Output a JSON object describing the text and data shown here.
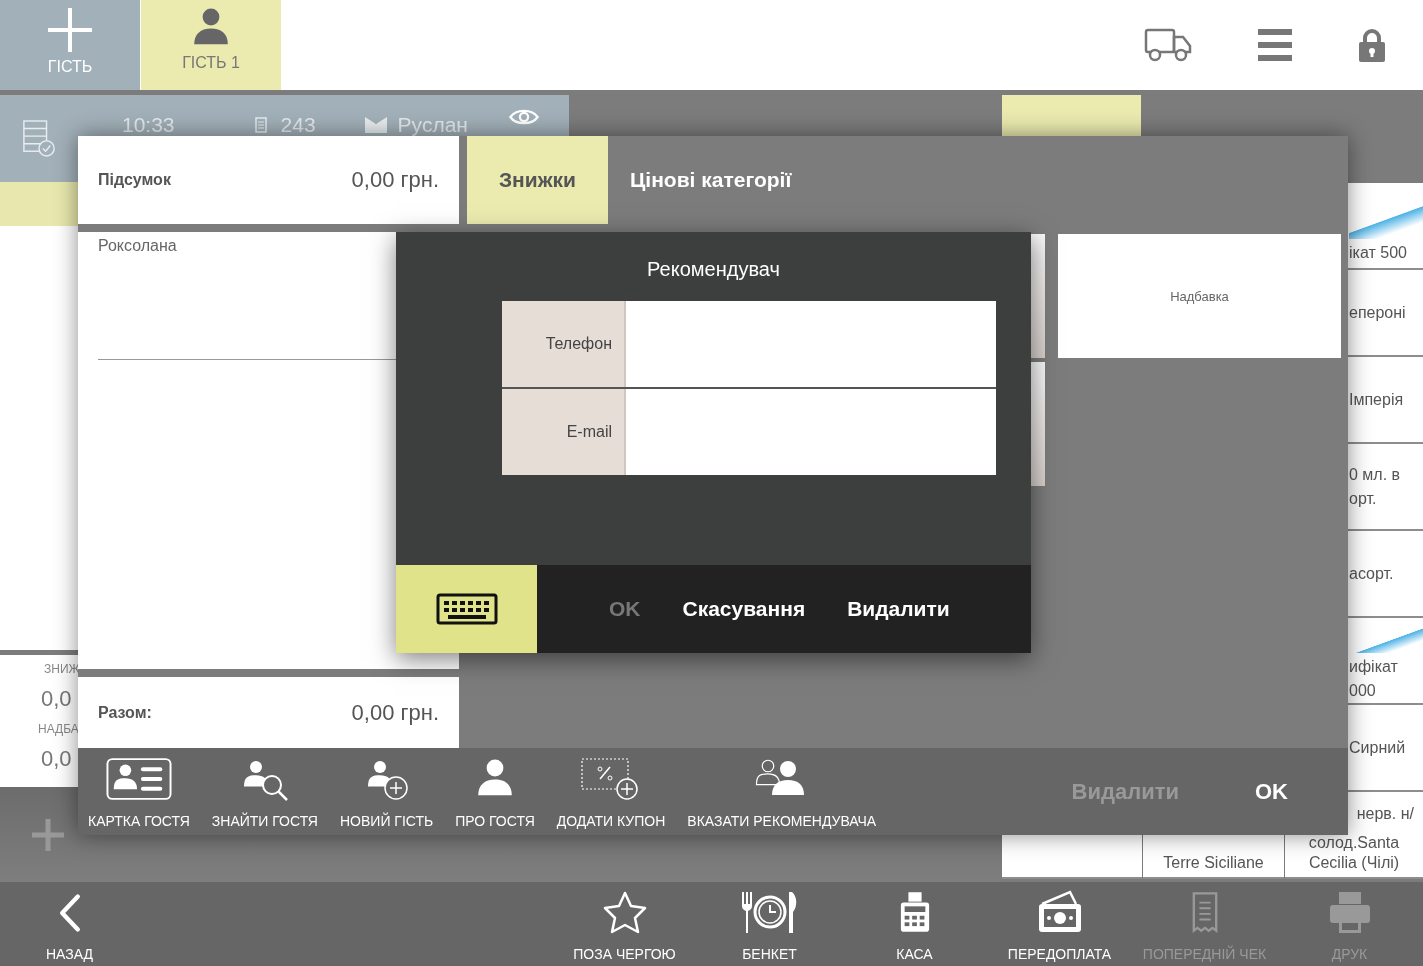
{
  "top_bar": {
    "guest_tabs": [
      {
        "kind": "add",
        "label": "ГІСТЬ",
        "selected": false
      },
      {
        "kind": "guest",
        "label": "ГІСТЬ 1",
        "selected": true
      }
    ]
  },
  "order_header": {
    "time": "10:33",
    "check_number": "243",
    "waiter": "Руслан"
  },
  "order_panel": {
    "discount_label": "ЗНИЖ",
    "discount_value": "0,0",
    "markup_label": "НАДБА",
    "markup_value": "0,0"
  },
  "menu": {
    "tabs": [
      {
        "selected": true
      }
    ],
    "products": [
      {
        "kind": "image",
        "lines": [
          "ікат 500"
        ]
      },
      {
        "kind": "text",
        "lines": [
          "епероні"
        ]
      },
      {
        "kind": "text",
        "lines": [
          "Імперія"
        ]
      },
      {
        "kind": "text",
        "lines": [
          "0 мл. в",
          "орт."
        ]
      },
      {
        "kind": "text",
        "lines": [
          "асорт."
        ]
      },
      {
        "kind": "image",
        "lines": [
          "ифікат",
          "000"
        ]
      },
      {
        "kind": "text",
        "lines": [
          "Сирний"
        ]
      },
      {
        "kind": "split",
        "lines": [
          "нерв. н/",
          "солод.Santa",
          "Cecilia (Чілі)"
        ]
      }
    ],
    "bottom_row": [
      {
        "kind": "covered"
      },
      {
        "kind": "text",
        "lines": [
          "Terre Siciliane"
        ]
      }
    ]
  },
  "guest_dialog": {
    "subtotal_label": "Підсумок",
    "subtotal_value": "0,00 грн.",
    "guest_name": "Роксолана",
    "total_label": "Разом:",
    "total_value": "0,00 грн.",
    "tabs": [
      {
        "label": "Знижки",
        "selected": true
      },
      {
        "label": "Цінові категорії",
        "selected": false
      }
    ],
    "tiles": [
      {
        "kind": "covered"
      },
      {
        "kind": "covered"
      },
      {
        "kind": "text",
        "label": "Надбавка"
      }
    ],
    "actions": [
      {
        "kind": "card",
        "label": "КАРТКА ГОСТЯ"
      },
      {
        "kind": "search",
        "label": "ЗНАЙТИ ГОСТЯ"
      },
      {
        "kind": "add",
        "label": "НОВИЙ ГІСТЬ"
      },
      {
        "kind": "person",
        "label": "ПРО ГОСТЯ"
      },
      {
        "kind": "coupon",
        "label": "ДОДАТИ КУПОН"
      },
      {
        "kind": "referrer",
        "label": "ВКАЗАТИ РЕКОМЕНДУВАЧА"
      }
    ],
    "footer_buttons": [
      {
        "label": "Видалити",
        "disabled": true
      },
      {
        "label": "OK",
        "disabled": false
      }
    ]
  },
  "referrer_modal": {
    "title": "Рекомендувач",
    "fields": [
      {
        "label": "Телефон"
      },
      {
        "label": "E-mail"
      }
    ],
    "buttons": [
      {
        "label": "OK",
        "disabled": true
      },
      {
        "label": "Скасування",
        "disabled": false
      },
      {
        "label": "Видалити",
        "disabled": false
      }
    ]
  },
  "bottom_bar": {
    "items": [
      {
        "kind": "back",
        "label": "НАЗАД",
        "disabled": false
      },
      {
        "kind": "star",
        "label": "ПОЗА ЧЕРГОЮ",
        "disabled": false
      },
      {
        "kind": "banquet",
        "label": "БЕНКЕТ",
        "disabled": false
      },
      {
        "kind": "cash",
        "label": "КАСА",
        "disabled": false
      },
      {
        "kind": "prepay",
        "label": "ПЕРЕДОПЛАТА",
        "disabled": false
      },
      {
        "kind": "receipt",
        "label": "ПОПЕРЕДНІЙ ЧЕК",
        "disabled": true
      },
      {
        "kind": "print",
        "label": "ДРУК",
        "disabled": true
      }
    ]
  }
}
